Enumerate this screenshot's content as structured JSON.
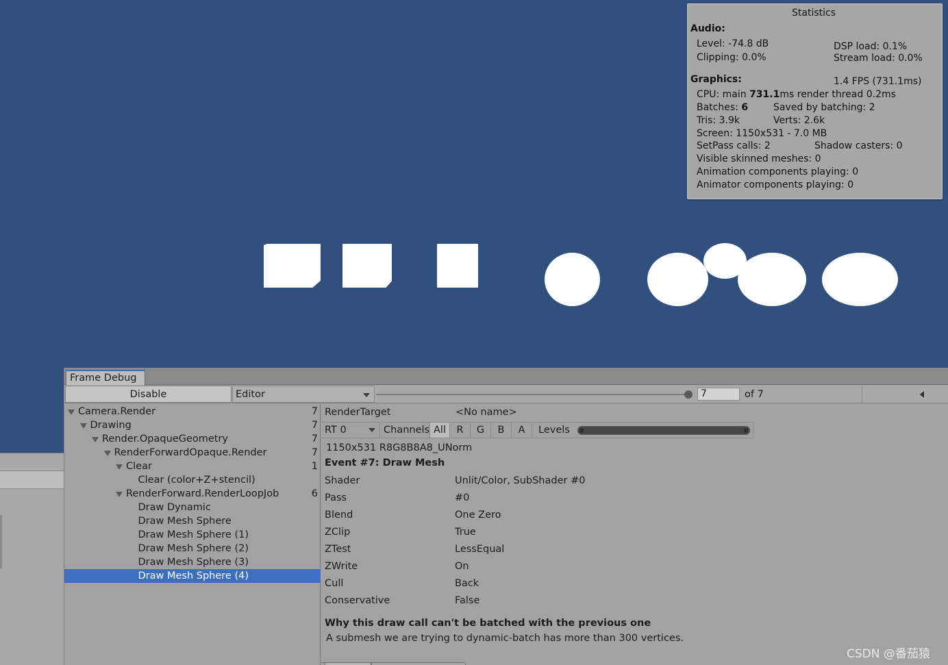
{
  "statistics": {
    "title": "Statistics",
    "audio": {
      "header": "Audio:",
      "level": "Level: -74.8 dB",
      "clipping": "Clipping: 0.0%",
      "dsp_load": "DSP load: 0.1%",
      "stream_load": "Stream load: 0.0%"
    },
    "graphics": {
      "header": "Graphics:",
      "fps": "1.4 FPS (731.1ms)",
      "cpu_prefix": "CPU: main ",
      "cpu_main": "731.1",
      "cpu_suffix": "ms  render thread 0.2ms",
      "batches_prefix": "Batches: ",
      "batches": "6",
      "saved_by_batching": "Saved by batching: 2",
      "tris": "Tris: 3.9k",
      "verts": "Verts: 2.6k",
      "screen": "Screen: 1150x531 - 7.0 MB",
      "setpass": "SetPass calls: 2",
      "shadow_casters": "Shadow casters: 0",
      "skinned_meshes": "Visible skinned meshes: 0",
      "animation_components": "Animation components playing: 0",
      "animator_components": "Animator components playing: 0"
    }
  },
  "frame_debug": {
    "tab_label": "Frame Debug",
    "disable_label": "Disable",
    "editor_dropdown": "Editor",
    "step_value": "7",
    "step_total_label": "of 7",
    "step_current": 7,
    "step_max": 7,
    "tree": [
      {
        "label": "Camera.Render",
        "count": "7",
        "depth": 0,
        "expanded": true,
        "selected": false
      },
      {
        "label": "Drawing",
        "count": "7",
        "depth": 1,
        "expanded": true,
        "selected": false
      },
      {
        "label": "Render.OpaqueGeometry",
        "count": "7",
        "depth": 2,
        "expanded": true,
        "selected": false
      },
      {
        "label": "RenderForwardOpaque.Render",
        "count": "7",
        "depth": 3,
        "expanded": true,
        "selected": false
      },
      {
        "label": "Clear",
        "count": "1",
        "depth": 4,
        "expanded": true,
        "selected": false
      },
      {
        "label": "Clear (color+Z+stencil)",
        "count": "",
        "depth": 5,
        "expanded": false,
        "selected": false
      },
      {
        "label": "RenderForward.RenderLoopJob",
        "count": "6",
        "depth": 4,
        "expanded": true,
        "selected": false
      },
      {
        "label": "Draw Dynamic",
        "count": "",
        "depth": 5,
        "expanded": false,
        "selected": false
      },
      {
        "label": "Draw Mesh Sphere",
        "count": "",
        "depth": 5,
        "expanded": false,
        "selected": false
      },
      {
        "label": "Draw Mesh Sphere (1)",
        "count": "",
        "depth": 5,
        "expanded": false,
        "selected": false
      },
      {
        "label": "Draw Mesh Sphere (2)",
        "count": "",
        "depth": 5,
        "expanded": false,
        "selected": false
      },
      {
        "label": "Draw Mesh Sphere (3)",
        "count": "",
        "depth": 5,
        "expanded": false,
        "selected": false
      },
      {
        "label": "Draw Mesh Sphere (4)",
        "count": "",
        "depth": 5,
        "expanded": false,
        "selected": true
      }
    ],
    "details": {
      "render_target_label": "RenderTarget",
      "render_target_value": "<No name>",
      "rt_dropdown": "RT 0",
      "channels_label": "Channels",
      "channel_buttons": [
        "All",
        "R",
        "G",
        "B",
        "A"
      ],
      "levels_label": "Levels",
      "format": "1150x531 R8G8B8A8_UNorm",
      "event_title": "Event #7: Draw Mesh",
      "properties": [
        {
          "name": "Shader",
          "value": "Unlit/Color, SubShader #0"
        },
        {
          "name": "Pass",
          "value": "#0"
        },
        {
          "name": "Blend",
          "value": "One Zero"
        },
        {
          "name": "ZClip",
          "value": "True"
        },
        {
          "name": "ZTest",
          "value": "LessEqual"
        },
        {
          "name": "ZWrite",
          "value": "On"
        },
        {
          "name": "Cull",
          "value": "Back"
        },
        {
          "name": "Conservative",
          "value": "False"
        }
      ],
      "batch_title": "Why this draw call can't be batched with the previous one",
      "batch_reason": "A submesh we are trying to dynamic-batch has more than 300 vertices."
    }
  },
  "watermark": "CSDN @番茄猿",
  "colors": {
    "scene_background": "#31507d",
    "selection": "#3d6fc1",
    "panel": "#a2a2a2"
  }
}
